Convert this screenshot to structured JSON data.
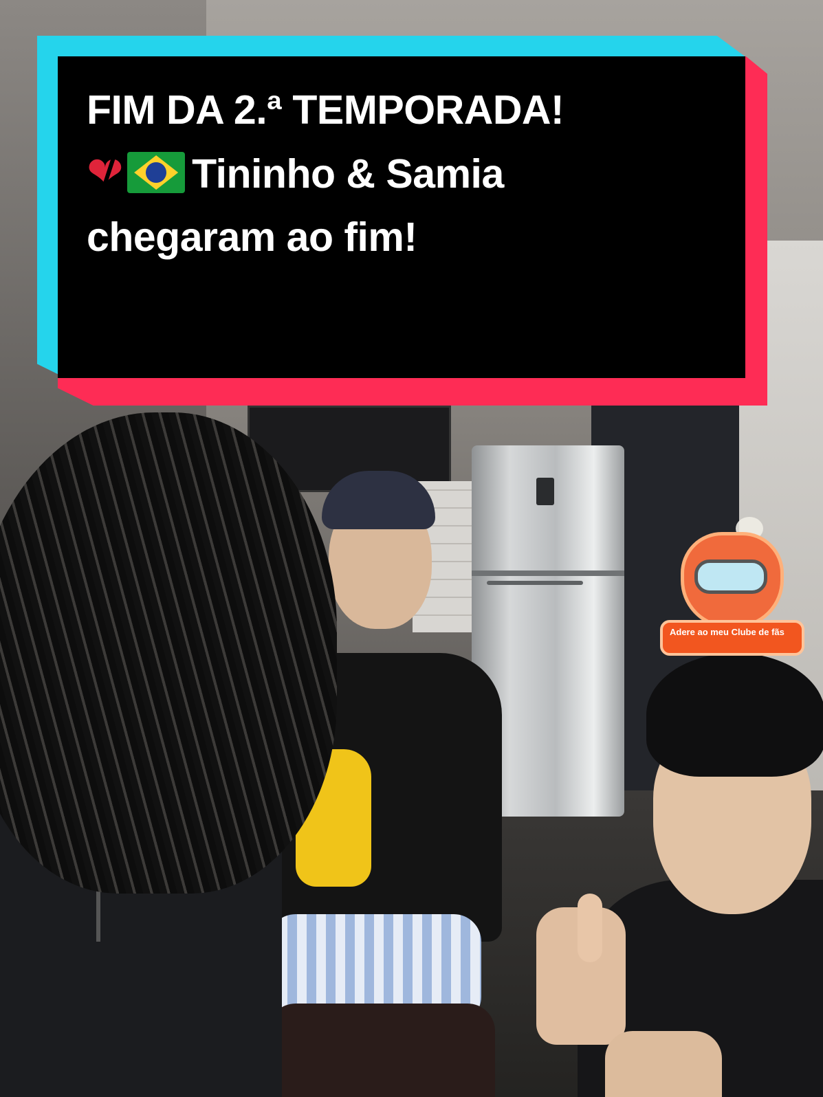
{
  "caption": {
    "line1": "FIM DA 2.ª TEMPORADA!",
    "line2_text": "Tininho & Samia",
    "line3": "chegaram ao fim!",
    "emoji_1": "broken-heart-icon",
    "emoji_2": "brazil-flag-icon",
    "colors": {
      "cyan": "#25d4ec",
      "red": "#fe2c55",
      "background": "#000000",
      "text": "#ffffff"
    }
  },
  "fan_club": {
    "label": "Adere ao meu Clube de fãs",
    "icon": "heart-mascot-icon",
    "color": "#f2561f"
  }
}
